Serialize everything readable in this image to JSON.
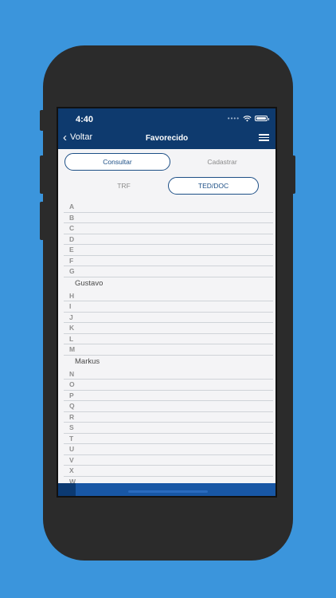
{
  "status": {
    "time": "4:40"
  },
  "nav": {
    "back_label": "Voltar",
    "title": "Favorecido"
  },
  "tabs_primary": [
    {
      "label": "Consultar",
      "active": true
    },
    {
      "label": "Cadastrar",
      "active": false
    }
  ],
  "tabs_secondary": [
    {
      "label": "TRF",
      "active": false
    },
    {
      "label": "TED/DOC",
      "active": true
    }
  ],
  "list": [
    {
      "type": "letter",
      "text": "A"
    },
    {
      "type": "letter",
      "text": "B"
    },
    {
      "type": "letter",
      "text": "C"
    },
    {
      "type": "letter",
      "text": "D"
    },
    {
      "type": "letter",
      "text": "E"
    },
    {
      "type": "letter",
      "text": "F"
    },
    {
      "type": "letter",
      "text": "G"
    },
    {
      "type": "contact",
      "text": "Gustavo"
    },
    {
      "type": "letter",
      "text": "H"
    },
    {
      "type": "letter",
      "text": "I"
    },
    {
      "type": "letter",
      "text": "J"
    },
    {
      "type": "letter",
      "text": "K"
    },
    {
      "type": "letter",
      "text": "L"
    },
    {
      "type": "letter",
      "text": "M"
    },
    {
      "type": "contact",
      "text": "Markus"
    },
    {
      "type": "letter",
      "text": "N"
    },
    {
      "type": "letter",
      "text": "O"
    },
    {
      "type": "letter",
      "text": "P"
    },
    {
      "type": "letter",
      "text": "Q"
    },
    {
      "type": "letter",
      "text": "R"
    },
    {
      "type": "letter",
      "text": "S"
    },
    {
      "type": "letter",
      "text": "T"
    },
    {
      "type": "letter",
      "text": "U"
    },
    {
      "type": "letter",
      "text": "V"
    },
    {
      "type": "letter",
      "text": "X"
    },
    {
      "type": "letter",
      "text": "W"
    }
  ],
  "colors": {
    "background": "#3b95dc",
    "header": "#0e3a6e",
    "accent": "#1d4f86"
  }
}
